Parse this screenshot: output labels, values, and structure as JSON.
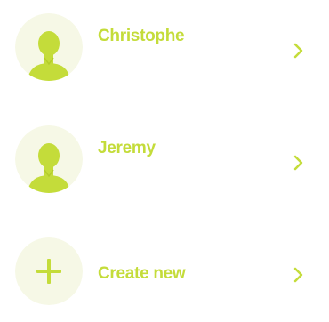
{
  "colors": {
    "accent": "#c4dc3a",
    "avatar_bg": "#f6f8e6",
    "chevron": "#c4dc3a"
  },
  "users": [
    {
      "name": "Christophe",
      "icon": "user-icon"
    },
    {
      "name": "Jeremy",
      "icon": "user-icon"
    }
  ],
  "create": {
    "label": "Create new",
    "icon": "plus-icon"
  },
  "chevron_icon": "chevron-right-icon"
}
